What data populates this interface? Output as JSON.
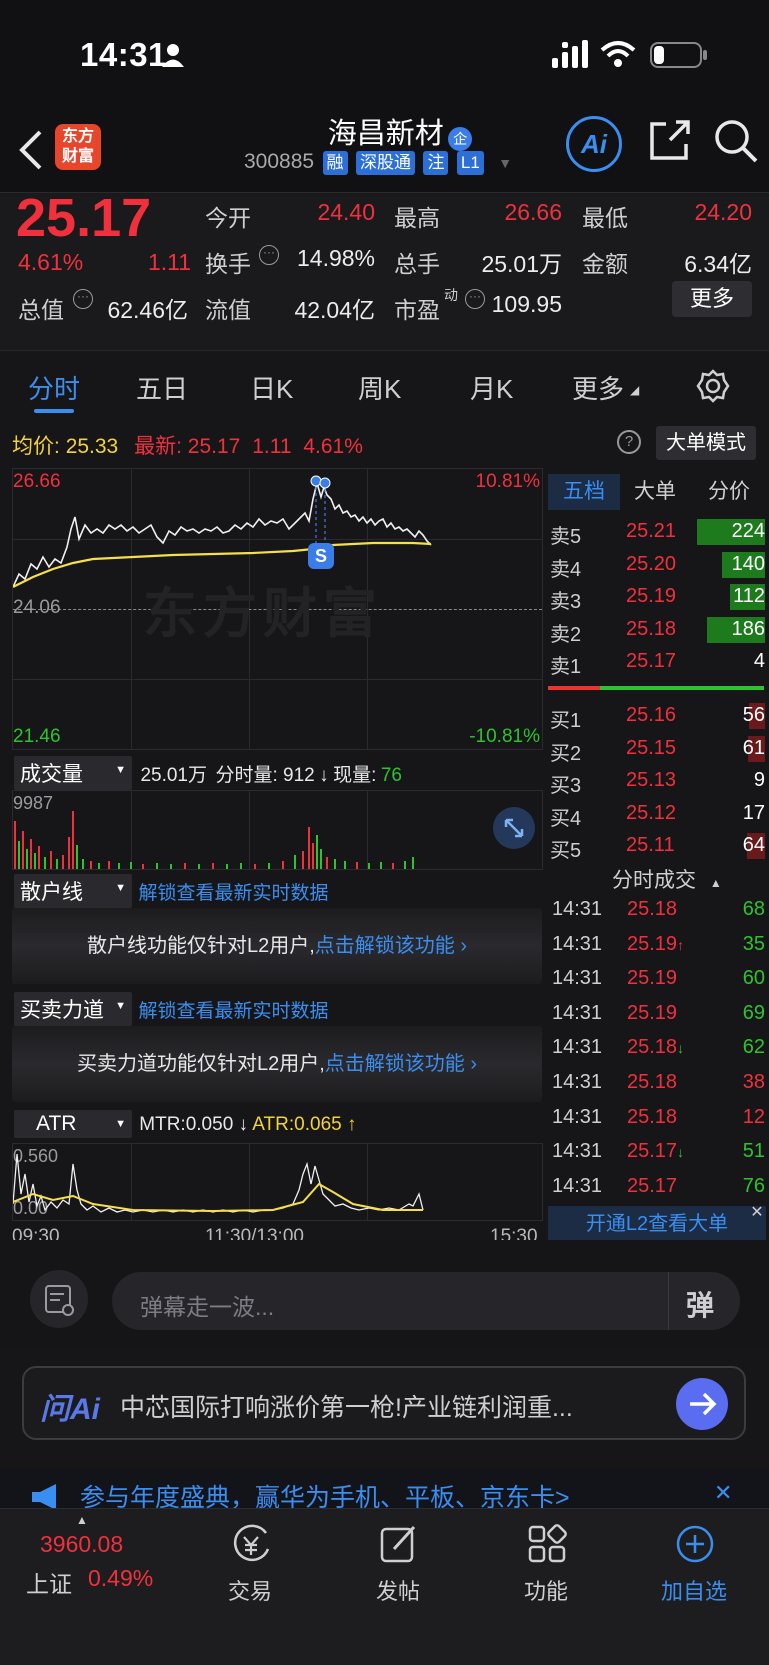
{
  "status_bar": {
    "time": "14:31"
  },
  "header": {
    "logo_text_1": "东方",
    "logo_text_2": "财富",
    "stock_name": "海昌新材",
    "badge": "企",
    "stock_code": "300885",
    "tags": [
      "融",
      "深股通",
      "注",
      "L1"
    ],
    "ai_label": "Ai"
  },
  "quote": {
    "price": "25.17",
    "change_pct": "4.61%",
    "change": "1.11",
    "stats": [
      {
        "label": "今开",
        "value": "24.40"
      },
      {
        "label": "最高",
        "value": "26.66"
      },
      {
        "label": "最低",
        "value": "24.20"
      },
      {
        "label": "换手",
        "value": "14.98%"
      },
      {
        "label": "总手",
        "value": "25.01万"
      },
      {
        "label": "金额",
        "value": "6.34亿"
      },
      {
        "label": "总值",
        "value": "62.46亿"
      },
      {
        "label": "流值",
        "value": "42.04亿"
      },
      {
        "label": "市盈",
        "value": "109.95"
      }
    ],
    "pe_superscript": "动",
    "more_button": "更多"
  },
  "tabs": [
    "分时",
    "五日",
    "日K",
    "周K",
    "月K",
    "更多"
  ],
  "avg_line": {
    "avg_label": "均价:",
    "avg_value": "25.33",
    "latest_label": "最新:",
    "latest_price": "25.17",
    "latest_change": "1.11",
    "latest_pct": "4.61%",
    "mode_button": "大单模式"
  },
  "chart": {
    "y_high": "26.66",
    "y_mid": "24.06",
    "y_low": "21.46",
    "pct_high": "10.81%",
    "pct_low": "-10.81%",
    "watermark": "东方财富",
    "marker": "S"
  },
  "volume_panel": {
    "label": "成交量",
    "total": "25.01万",
    "fenshi_label": "分时量: 912",
    "xian_label": "现量:",
    "xian_value": "76",
    "y_max": "9987"
  },
  "retail_panel": {
    "label": "散户线",
    "unlock_link": "解锁查看最新实时数据",
    "notice": "散户线功能仅针对L2用户,",
    "notice_link": "点击解锁该功能"
  },
  "force_panel": {
    "label": "买卖力道",
    "unlock_link": "解锁查看最新实时数据",
    "notice": "买卖力道功能仅针对L2用户,",
    "notice_link": "点击解锁该功能"
  },
  "atr_panel": {
    "label": "ATR",
    "mtr": "MTR:0.050",
    "atr": "ATR:0.065",
    "y_max": "0.560",
    "y_min": "0.00"
  },
  "time_axis": [
    "09:30",
    "11:30/13:00",
    "15:30"
  ],
  "orderbook": {
    "tabs": [
      "五档",
      "大单",
      "分价"
    ],
    "asks": [
      {
        "label": "卖5",
        "price": "25.21",
        "vol": "224",
        "fill": 0.95
      },
      {
        "label": "卖4",
        "price": "25.20",
        "vol": "140",
        "fill": 0.6
      },
      {
        "label": "卖3",
        "price": "25.19",
        "vol": "112",
        "fill": 0.48
      },
      {
        "label": "卖2",
        "price": "25.18",
        "vol": "186",
        "fill": 0.8
      },
      {
        "label": "卖1",
        "price": "25.17",
        "vol": "4",
        "fill": 0
      }
    ],
    "bids": [
      {
        "label": "买1",
        "price": "25.16",
        "vol": "56",
        "fill": 0.22
      },
      {
        "label": "买2",
        "price": "25.15",
        "vol": "61",
        "fill": 0.24
      },
      {
        "label": "买3",
        "price": "25.13",
        "vol": "9",
        "fill": 0
      },
      {
        "label": "买4",
        "price": "25.12",
        "vol": "17",
        "fill": 0
      },
      {
        "label": "买5",
        "price": "25.11",
        "vol": "64",
        "fill": 0.25
      }
    ],
    "ticks_title": "分时成交",
    "ticks": [
      {
        "time": "14:31",
        "price": "25.18",
        "arrow": "",
        "vol": "68",
        "color": "green"
      },
      {
        "time": "14:31",
        "price": "25.19",
        "arrow": "↑",
        "vol": "35",
        "color": "green"
      },
      {
        "time": "14:31",
        "price": "25.19",
        "arrow": "",
        "vol": "60",
        "color": "green"
      },
      {
        "time": "14:31",
        "price": "25.19",
        "arrow": "",
        "vol": "69",
        "color": "green"
      },
      {
        "time": "14:31",
        "price": "25.18",
        "arrow": "↓",
        "vol": "62",
        "color": "green"
      },
      {
        "time": "14:31",
        "price": "25.18",
        "arrow": "",
        "vol": "38",
        "color": "red"
      },
      {
        "time": "14:31",
        "price": "25.18",
        "arrow": "",
        "vol": "12",
        "color": "red"
      },
      {
        "time": "14:31",
        "price": "25.17",
        "arrow": "↓",
        "vol": "51",
        "color": "green"
      },
      {
        "time": "14:31",
        "price": "25.17",
        "arrow": "",
        "vol": "76",
        "color": "green"
      }
    ],
    "l2_banner": "开通L2查看大单"
  },
  "comment_bar": {
    "placeholder": "弹幕走一波...",
    "danmu_glyph": "弹"
  },
  "ai_bar": {
    "label": "问Ai",
    "text": "中芯国际打响涨价第一枪!产业链利润重..."
  },
  "promo": {
    "text": "参与年度盛典，赢华为手机、平板、京东卡>"
  },
  "bottom_nav": {
    "index_value": "3960.08",
    "index_name": "上证",
    "index_pct": "0.49%",
    "items": [
      "交易",
      "发帖",
      "功能",
      "加自选"
    ]
  }
}
